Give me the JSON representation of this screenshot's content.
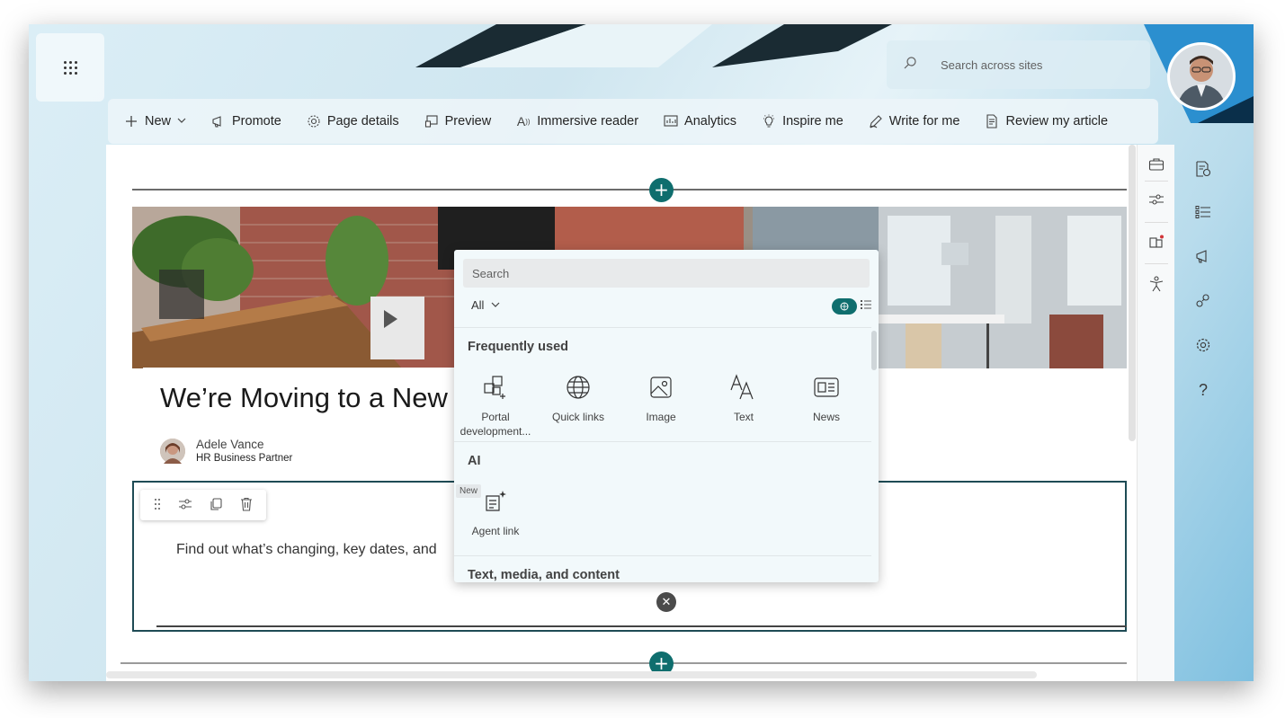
{
  "app": {
    "search_placeholder": "Search across sites"
  },
  "toolbar": {
    "items": [
      {
        "label": "New",
        "icon": "plus-icon"
      },
      {
        "label": "Promote",
        "icon": "megaphone-icon"
      },
      {
        "label": "Page details",
        "icon": "gear-icon"
      },
      {
        "label": "Preview",
        "icon": "preview-icon"
      },
      {
        "label": "Immersive reader",
        "icon": "immersive-reader-icon"
      },
      {
        "label": "Analytics",
        "icon": "analytics-icon"
      },
      {
        "label": "Inspire me",
        "icon": "lightbulb-icon"
      },
      {
        "label": "Write for me",
        "icon": "pen-icon"
      },
      {
        "label": "Review my article",
        "icon": "document-review-icon"
      }
    ]
  },
  "page": {
    "title": "We’re Moving to a New",
    "author_name": "Adele Vance",
    "author_role": "HR Business Partner",
    "body_text": "Find out what’s changing, key dates, and"
  },
  "toolbox": {
    "search_placeholder": "Search",
    "filter_label": "All",
    "sections": {
      "frequently_used": "Frequently used",
      "ai": "AI",
      "text_media": "Text, media, and content"
    },
    "frequent_items": [
      {
        "label": "Portal development...",
        "icon": "portal-icon"
      },
      {
        "label": "Quick links",
        "icon": "globe-icon"
      },
      {
        "label": "Image",
        "icon": "image-icon"
      },
      {
        "label": "Text",
        "icon": "text-icon"
      },
      {
        "label": "News",
        "icon": "news-icon"
      }
    ],
    "ai_items": [
      {
        "label": "Agent link",
        "icon": "agent-link-icon",
        "badge": "New"
      }
    ]
  },
  "colors": {
    "accent": "#0f6e6e",
    "section_border": "#1e4b55"
  }
}
